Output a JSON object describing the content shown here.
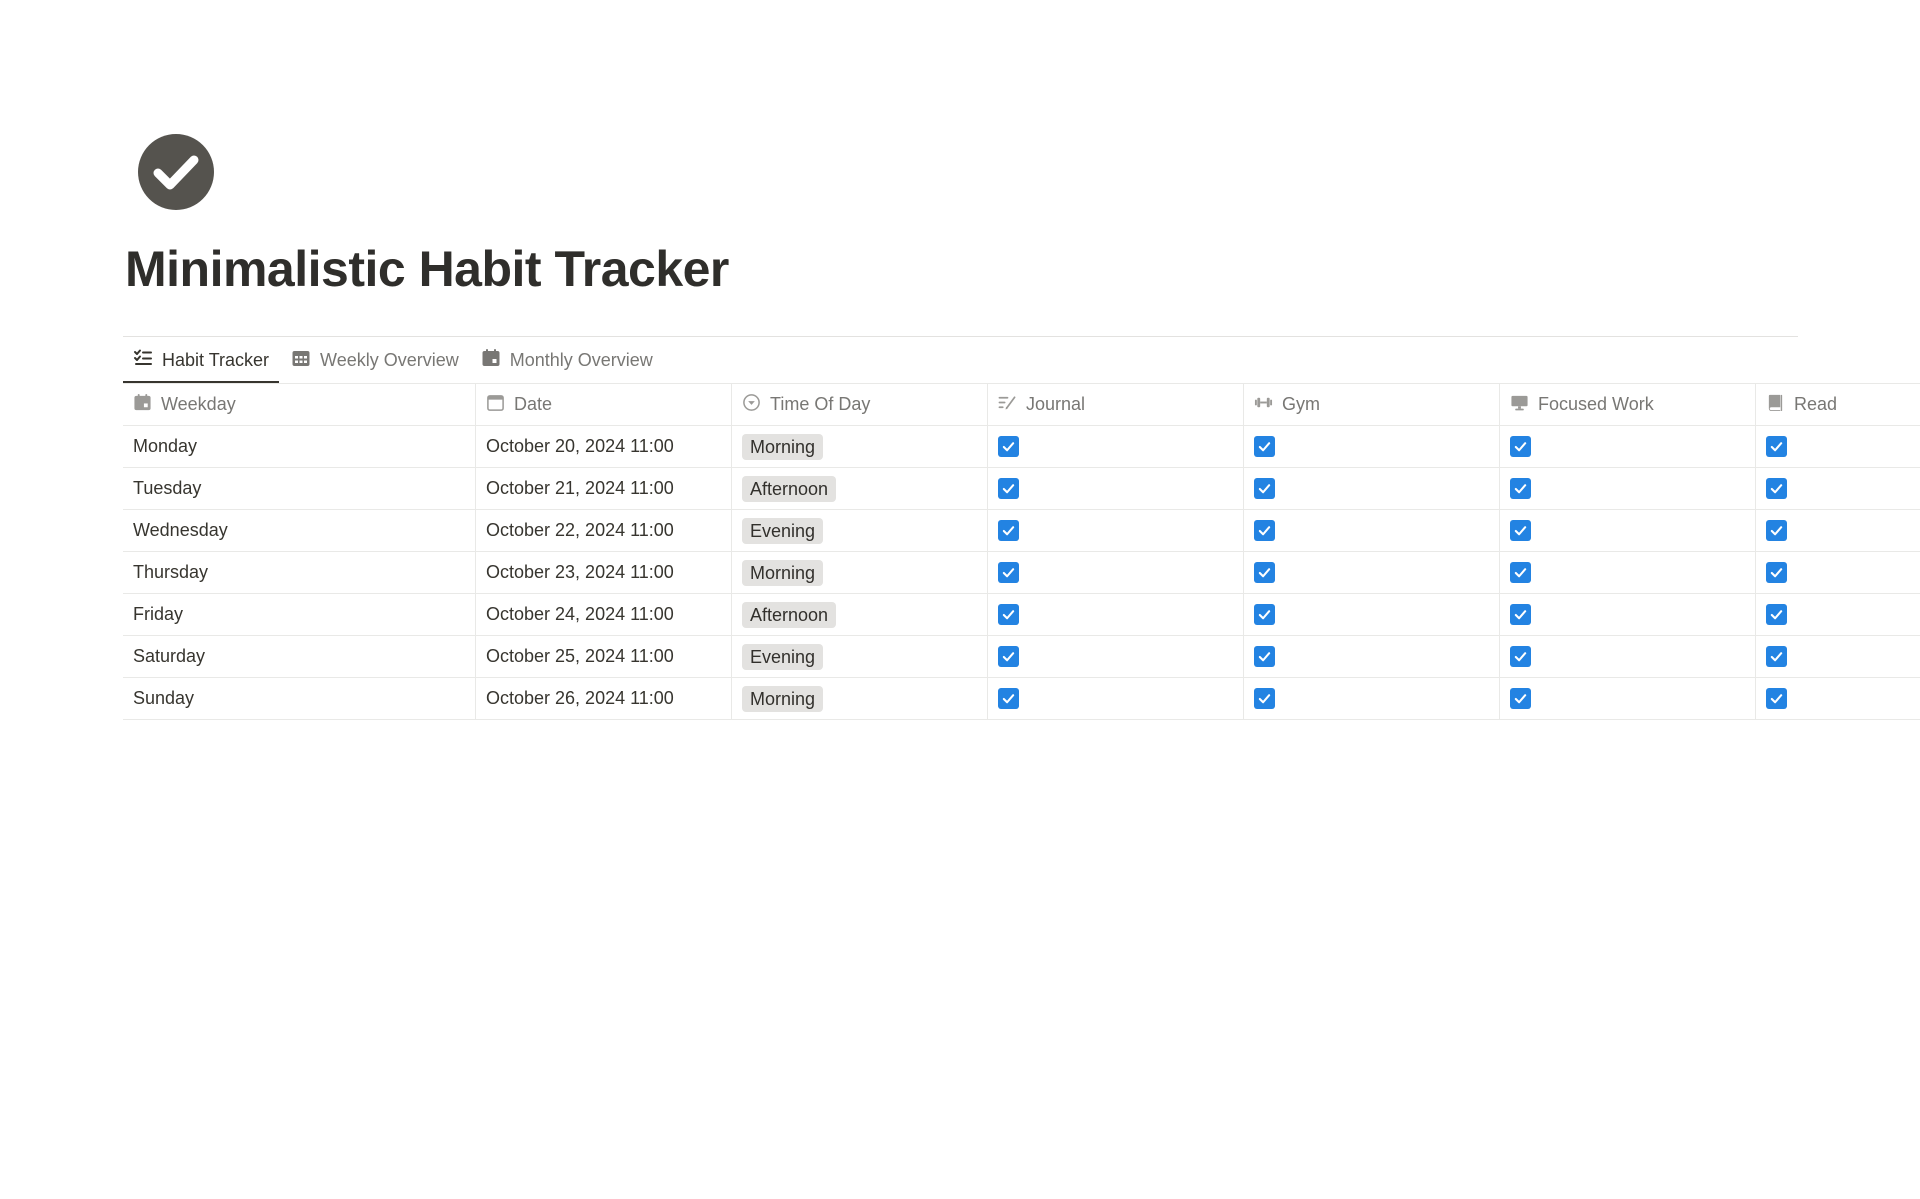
{
  "page": {
    "icon": "check-circle-icon",
    "title": "Minimalistic Habit Tracker"
  },
  "tabs": [
    {
      "label": "Habit Tracker",
      "icon": "checklist-icon",
      "active": true
    },
    {
      "label": "Weekly Overview",
      "icon": "calendar-grid-icon",
      "active": false
    },
    {
      "label": "Monthly Overview",
      "icon": "calendar-icon",
      "active": false
    }
  ],
  "columns": {
    "weekday": "Weekday",
    "date": "Date",
    "time_of_day": "Time Of Day",
    "journal": "Journal",
    "gym": "Gym",
    "focused_work": "Focused Work",
    "read": "Read"
  },
  "rows": [
    {
      "weekday": "Monday",
      "date": "October 20, 2024 11:00",
      "time_of_day": "Morning",
      "journal": true,
      "gym": true,
      "focused_work": true,
      "read": true
    },
    {
      "weekday": "Tuesday",
      "date": "October 21, 2024 11:00",
      "time_of_day": "Afternoon",
      "journal": true,
      "gym": true,
      "focused_work": true,
      "read": true
    },
    {
      "weekday": "Wednesday",
      "date": "October 22, 2024 11:00",
      "time_of_day": "Evening",
      "journal": true,
      "gym": true,
      "focused_work": true,
      "read": true
    },
    {
      "weekday": "Thursday",
      "date": "October 23, 2024 11:00",
      "time_of_day": "Morning",
      "journal": true,
      "gym": true,
      "focused_work": true,
      "read": true
    },
    {
      "weekday": "Friday",
      "date": "October 24, 2024 11:00",
      "time_of_day": "Afternoon",
      "journal": true,
      "gym": true,
      "focused_work": true,
      "read": true
    },
    {
      "weekday": "Saturday",
      "date": "October 25, 2024 11:00",
      "time_of_day": "Evening",
      "journal": true,
      "gym": true,
      "focused_work": true,
      "read": true
    },
    {
      "weekday": "Sunday",
      "date": "October 26, 2024 11:00",
      "time_of_day": "Morning",
      "journal": true,
      "gym": true,
      "focused_work": true,
      "read": true
    }
  ],
  "colors": {
    "checkbox": "#2383e2",
    "tag_bg": "#e3e2e0",
    "icon": "#55534e"
  }
}
